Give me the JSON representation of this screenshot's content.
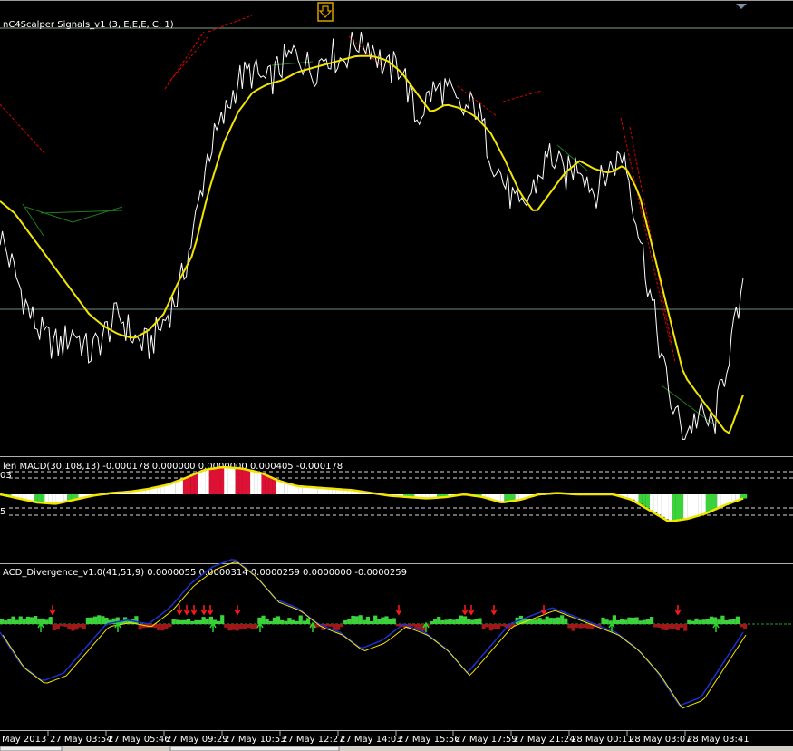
{
  "colors": {
    "background": "#000000",
    "price": "#ffffff",
    "ma": "#f2e600",
    "signal_red": "#e00000",
    "signal_green": "#1f7a1f",
    "hist_green": "#3cd23c",
    "hist_red": "#dd1133",
    "hist_darkred": "#a01818",
    "blue": "#1d2fd0",
    "separator": "#b0b0b0",
    "level_line": "#7fa58a",
    "marker": "#d8a000",
    "dashed": "#d8d8d8",
    "arrow_red": "#ff1a1a",
    "arrow_green": "#2bd62b"
  },
  "panels": {
    "main": {
      "label": "nC4Scalper Signals_v1 (3, E,E,E, C; 1)",
      "marker_icon": "arrow-down-icon"
    },
    "macd": {
      "label": "len MACD(30,108,13) -0.000178 0.000000 0.0000000 0.000405 -0.000178",
      "level_top": "03",
      "level_bottom": "5"
    },
    "divergence": {
      "label": "ACD_Divergence_v1.0(41,51,9) 0.0000055 0.0000314 0.0000259 0.0000000 -0.0000259"
    }
  },
  "time_axis": {
    "ticks": [
      "May 2013",
      "27 May 03:54",
      "27 May 05:46",
      "27 May 09:29",
      "27 May 10:53",
      "27 May 12:27",
      "27 May 14:03",
      "27 May 15:56",
      "27 May 17:59",
      "27 May 21:24",
      "28 May 00:11",
      "28 May 03:07",
      "28 May 03:41"
    ]
  },
  "chart_data": [
    {
      "type": "line",
      "panel": "main",
      "series": [
        {
          "values": [
            0.58,
            0.55,
            0.5,
            0.45,
            0.4,
            0.35,
            0.3,
            0.27,
            0.25,
            0.24,
            0.26,
            0.3,
            0.38,
            0.45,
            0.6,
            0.72,
            0.8,
            0.85,
            0.87,
            0.88,
            0.9,
            0.91,
            0.92,
            0.93,
            0.94,
            0.94,
            0.93,
            0.9,
            0.85,
            0.8,
            0.82,
            0.81,
            0.79,
            0.75,
            0.68,
            0.6,
            0.55,
            0.6,
            0.65,
            0.68,
            0.66,
            0.65,
            0.67,
            0.6,
            0.45,
            0.3,
            0.15,
            0.1,
            0.05,
            0.0,
            0.1
          ]
        },
        {
          "values": [
            0.5,
            0.4,
            0.3,
            0.24,
            0.22,
            0.26,
            0.2,
            0.25,
            0.3,
            0.24,
            0.22,
            0.28,
            0.35,
            0.5,
            0.7,
            0.78,
            0.88,
            0.9,
            0.87,
            0.92,
            0.95,
            0.9,
            0.95,
            0.93,
            0.98,
            0.97,
            0.9,
            0.92,
            0.78,
            0.85,
            0.86,
            0.8,
            0.82,
            0.7,
            0.62,
            0.55,
            0.62,
            0.7,
            0.64,
            0.68,
            0.6,
            0.66,
            0.7,
            0.5,
            0.3,
            0.1,
            0.0,
            0.05,
            0.02,
            0.2,
            0.35
          ]
        }
      ]
    },
    {
      "type": "area",
      "panel": "macd",
      "series": [
        {
          "values": [
            0.0,
            -0.15,
            -0.3,
            -0.35,
            -0.2,
            -0.05,
            0.05,
            0.1,
            0.2,
            0.35,
            0.6,
            0.9,
            1.0,
            0.95,
            0.8,
            0.5,
            0.3,
            0.25,
            0.2,
            0.15,
            0.05,
            -0.05,
            -0.1,
            -0.15,
            -0.1,
            0.0,
            -0.1,
            -0.3,
            -0.2,
            0.0,
            0.05,
            0.0,
            0.0,
            0.0,
            -0.2,
            -0.6,
            -1.0,
            -0.9,
            -0.7,
            -0.4,
            -0.15
          ]
        }
      ]
    },
    {
      "type": "area",
      "panel": "divergence",
      "series": [
        {
          "values": [
            -0.1,
            -0.5,
            -0.7,
            -0.6,
            -0.3,
            0.0,
            0.05,
            0.0,
            0.2,
            0.5,
            0.7,
            0.8,
            0.6,
            0.3,
            0.2,
            0.0,
            -0.1,
            -0.3,
            -0.2,
            0.0,
            -0.1,
            -0.3,
            -0.6,
            -0.3,
            0.0,
            0.1,
            0.2,
            0.1,
            0.0,
            -0.1,
            -0.3,
            -0.6,
            -1.0,
            -0.9,
            -0.5,
            -0.1
          ]
        }
      ]
    }
  ]
}
